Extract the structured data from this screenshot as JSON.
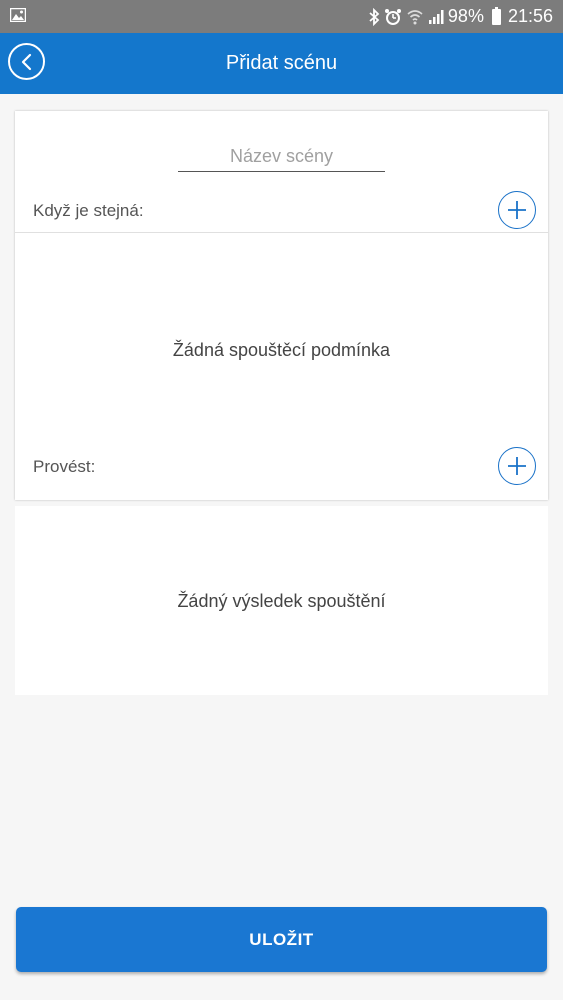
{
  "status_bar": {
    "battery": "98%",
    "time": "21:56",
    "icons": [
      "image-icon",
      "bluetooth-icon",
      "alarm-icon",
      "wifi-icon",
      "signal-icon",
      "battery-icon"
    ]
  },
  "app_bar": {
    "title": "Přidat scénu",
    "back_icon": "back-circle-icon",
    "color": "#1477cc"
  },
  "scene_form": {
    "name_placeholder": "Název scény",
    "trigger_label": "Když je stejná:",
    "trigger_empty": "Žádná spouštěcí podmínka",
    "action_label": "Provést:",
    "action_empty": "Žádný výsledek spouštění",
    "add_icon": "plus-circle-icon",
    "accent": "#1a72c8"
  },
  "footer": {
    "save_label": "ULOŽIT",
    "button_color": "#1a77d2"
  }
}
